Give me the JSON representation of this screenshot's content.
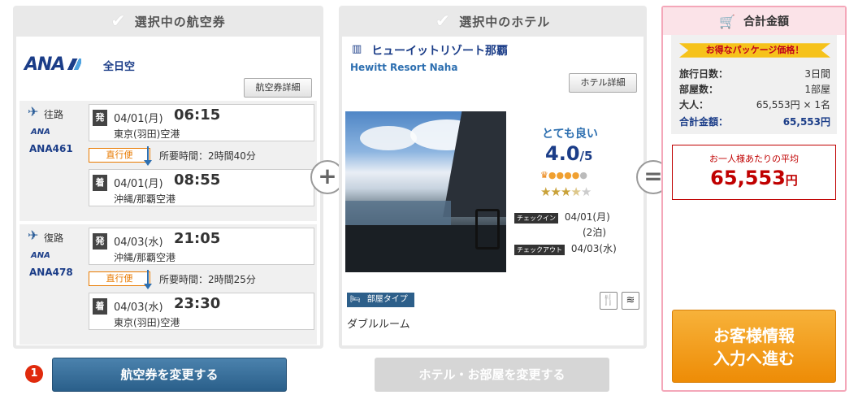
{
  "flight_panel": {
    "header": "選択中の航空券",
    "airline_logo": "ANA",
    "airline_name": "全日空",
    "details_button": "航空券詳細",
    "outbound": {
      "direction": "往路",
      "logo": "ANA",
      "flight_no": "ANA461",
      "dep_tag": "発",
      "dep_date": "04/01(月)",
      "dep_time": "06:15",
      "dep_airport": "東京(羽田)空港",
      "direct": "直行便",
      "duration": "所要時間：2時間40分",
      "arr_tag": "着",
      "arr_date": "04/01(月)",
      "arr_time": "08:55",
      "arr_airport": "沖縄/那覇空港"
    },
    "return": {
      "direction": "復路",
      "logo": "ANA",
      "flight_no": "ANA478",
      "dep_tag": "発",
      "dep_date": "04/03(水)",
      "dep_time": "21:05",
      "dep_airport": "沖縄/那覇空港",
      "direct": "直行便",
      "duration": "所要時間：2時間25分",
      "arr_tag": "着",
      "arr_date": "04/03(水)",
      "arr_time": "23:30",
      "arr_airport": "東京(羽田)空港"
    },
    "change_button": "航空券を変更する",
    "step_number": "1"
  },
  "hotel_panel": {
    "header": "選択中のホテル",
    "hotel_icon": "building-icon",
    "hotel_name": "ヒューイットリゾート那覇",
    "hotel_name_en": "Hewitt Resort Naha",
    "details_button": "ホテル詳細",
    "rating_label": "とても良い",
    "rating_value": "4.0",
    "rating_max": "/5",
    "rating_score": 4.0,
    "hotel_class_stars": 3.5,
    "checkin_label": "チェックイン",
    "checkin_date": "04/01(月)",
    "nights": "(2泊)",
    "checkout_label": "チェックアウト",
    "checkout_date": "04/03(水)",
    "room_type_label": "部屋タイプ",
    "room_type": "ダブルルーム",
    "amenity_icons": [
      "restaurant-icon",
      "wifi-icon"
    ],
    "change_button": "ホテル・お部屋を変更する"
  },
  "plus_symbol": "+",
  "equals_symbol": "=",
  "total_panel": {
    "header": "合計金額",
    "ribbon": "お得なパッケージ価格！",
    "rows": [
      {
        "label": "旅行日数：",
        "value": "3日間"
      },
      {
        "label": "部屋数：",
        "value": "1部屋"
      },
      {
        "label": "大人：",
        "value": "65,553円 × 1名"
      }
    ],
    "total_label": "合計金額：",
    "total_value": "65,553円",
    "avg_label": "お一人様あたりの平均",
    "avg_amount": "65,553",
    "avg_unit": "円",
    "proceed_line1": "お客様情報",
    "proceed_line2": "入力へ進む"
  },
  "colors": {
    "ana_blue": "#1b3d88",
    "orange": "#e87a00",
    "red": "#c00000",
    "pink_border": "#f4a7b9",
    "change_button": "#3a6f9a",
    "proceed_button": "#f29a12"
  }
}
